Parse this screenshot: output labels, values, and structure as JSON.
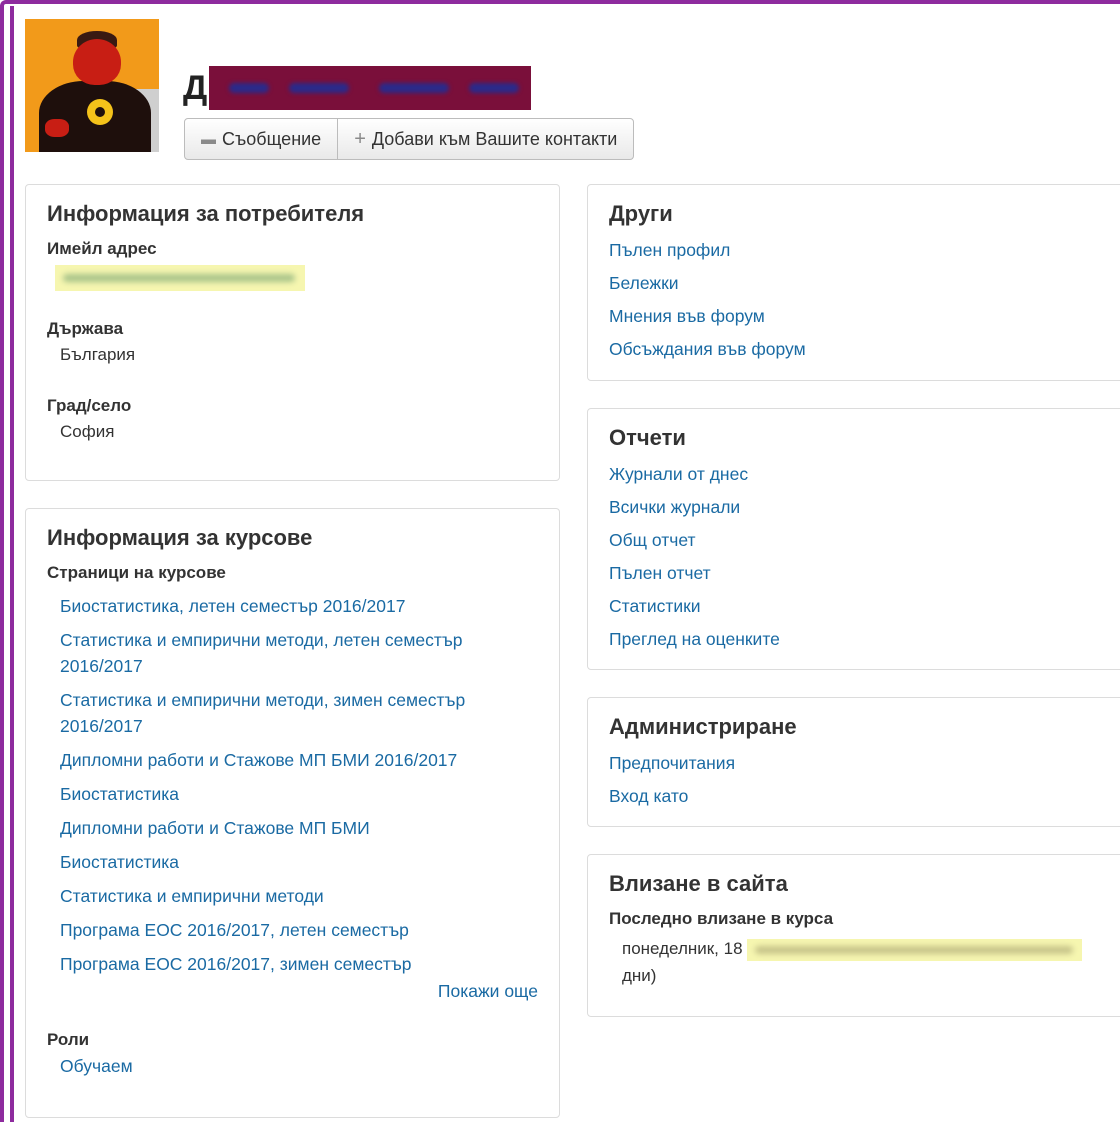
{
  "profile": {
    "name_visible": "Д",
    "buttons": {
      "message": "Съобщение",
      "add_contact": "Добави към Вашите контакти"
    }
  },
  "user_info": {
    "title": "Информация за потребителя",
    "email_label": "Имейл адрес",
    "country_label": "Държава",
    "country_value": "България",
    "city_label": "Град/село",
    "city_value": "София"
  },
  "course_info": {
    "title": "Информация за курсове",
    "course_pages_label": "Страници на курсове",
    "courses": [
      "Биостатистика, летен семестър 2016/2017",
      "Статистика и емпирични методи, летен семестър 2016/2017",
      "Статистика и емпирични методи, зимен семестър 2016/2017",
      "Дипломни работи и Стажове МП БМИ 2016/2017",
      "Биостатистика",
      "Дипломни работи и Стажове МП БМИ",
      "Биостатистика",
      "Статистика и емпирични методи",
      "Програма ЕОС 2016/2017, летен семестър",
      "Програма ЕОС 2016/2017, зимен семестър"
    ],
    "show_more": "Покажи още",
    "roles_label": "Роли",
    "roles_value": "Обучаем"
  },
  "other": {
    "title": "Други",
    "links": [
      "Пълен профил",
      "Бележки",
      "Мнения във форум",
      "Обсъждания във форум"
    ]
  },
  "reports": {
    "title": "Отчети",
    "links": [
      "Журнали от днес",
      "Всички журнали",
      "Общ отчет",
      "Пълен отчет",
      "Статистики",
      "Преглед на оценките"
    ]
  },
  "administration": {
    "title": "Администриране",
    "links": [
      "Предпочитания",
      "Вход като"
    ]
  },
  "site_login": {
    "title": "Влизане в сайта",
    "last_access_label": "Последно влизане в курса",
    "last_access_prefix": "понеделник, 18",
    "last_access_suffix": "дни)"
  },
  "colors": {
    "frame": "#8e2b9e",
    "link": "#1a6aa3"
  }
}
